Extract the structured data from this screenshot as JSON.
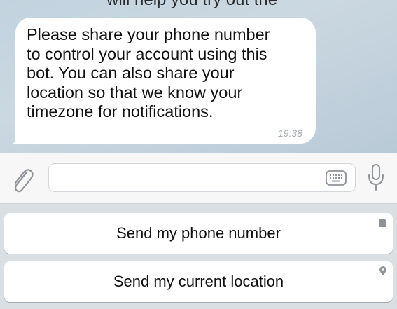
{
  "chat": {
    "top_clipped_text": "will help you try out the",
    "message": {
      "text": "Please share your phone number to control your account using this bot. You can also share your location so that we know your timezone for notifications.",
      "time": "19:38"
    }
  },
  "input_bar": {
    "placeholder": "",
    "icons": [
      "paperclip-icon",
      "keyboard-icon",
      "microphone-icon"
    ]
  },
  "reply_keyboard": {
    "buttons": [
      {
        "label": "Send my phone number",
        "icon": "contact-icon"
      },
      {
        "label": "Send my current location",
        "icon": "location-pin-icon"
      }
    ]
  },
  "colors": {
    "chat_background": "#c4d4df",
    "bubble": "#ffffff",
    "input_bar": "#f7f7f7",
    "keyboard_background": "#dadfe4",
    "icon_gray": "#8e9399"
  }
}
